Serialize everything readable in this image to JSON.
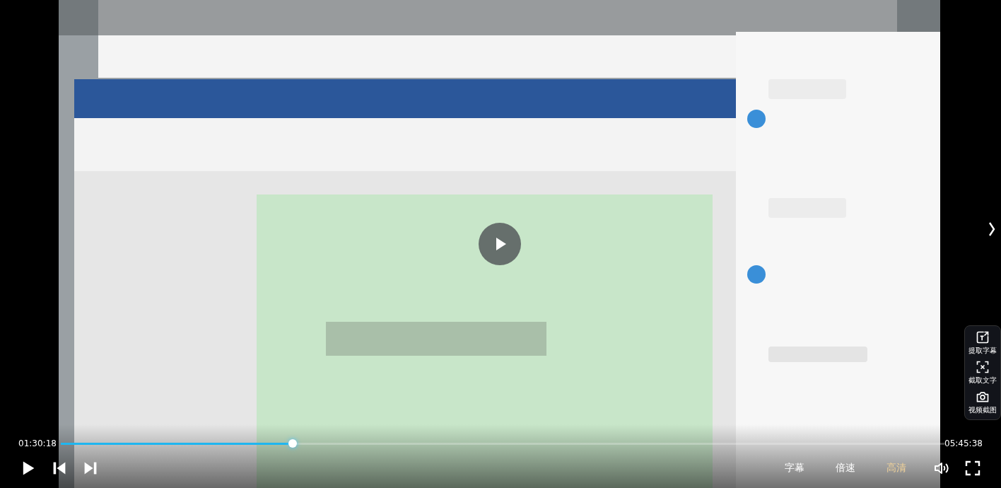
{
  "player": {
    "playing": false,
    "elapsed": "01:30:18",
    "duration": "05:45:38",
    "progress": {
      "level": 0.262
    },
    "text_buttons": [
      {
        "label": "字幕",
        "selected": false
      },
      {
        "label": "倍速",
        "selected": false
      },
      {
        "label": "高清",
        "selected": true
      }
    ],
    "muted": false,
    "side_tools": [
      {
        "label": "提取字幕",
        "kind": "subtitle"
      },
      {
        "label": "截取文字",
        "kind": "ocr"
      },
      {
        "label": "视频截图",
        "kind": "camera"
      }
    ]
  }
}
